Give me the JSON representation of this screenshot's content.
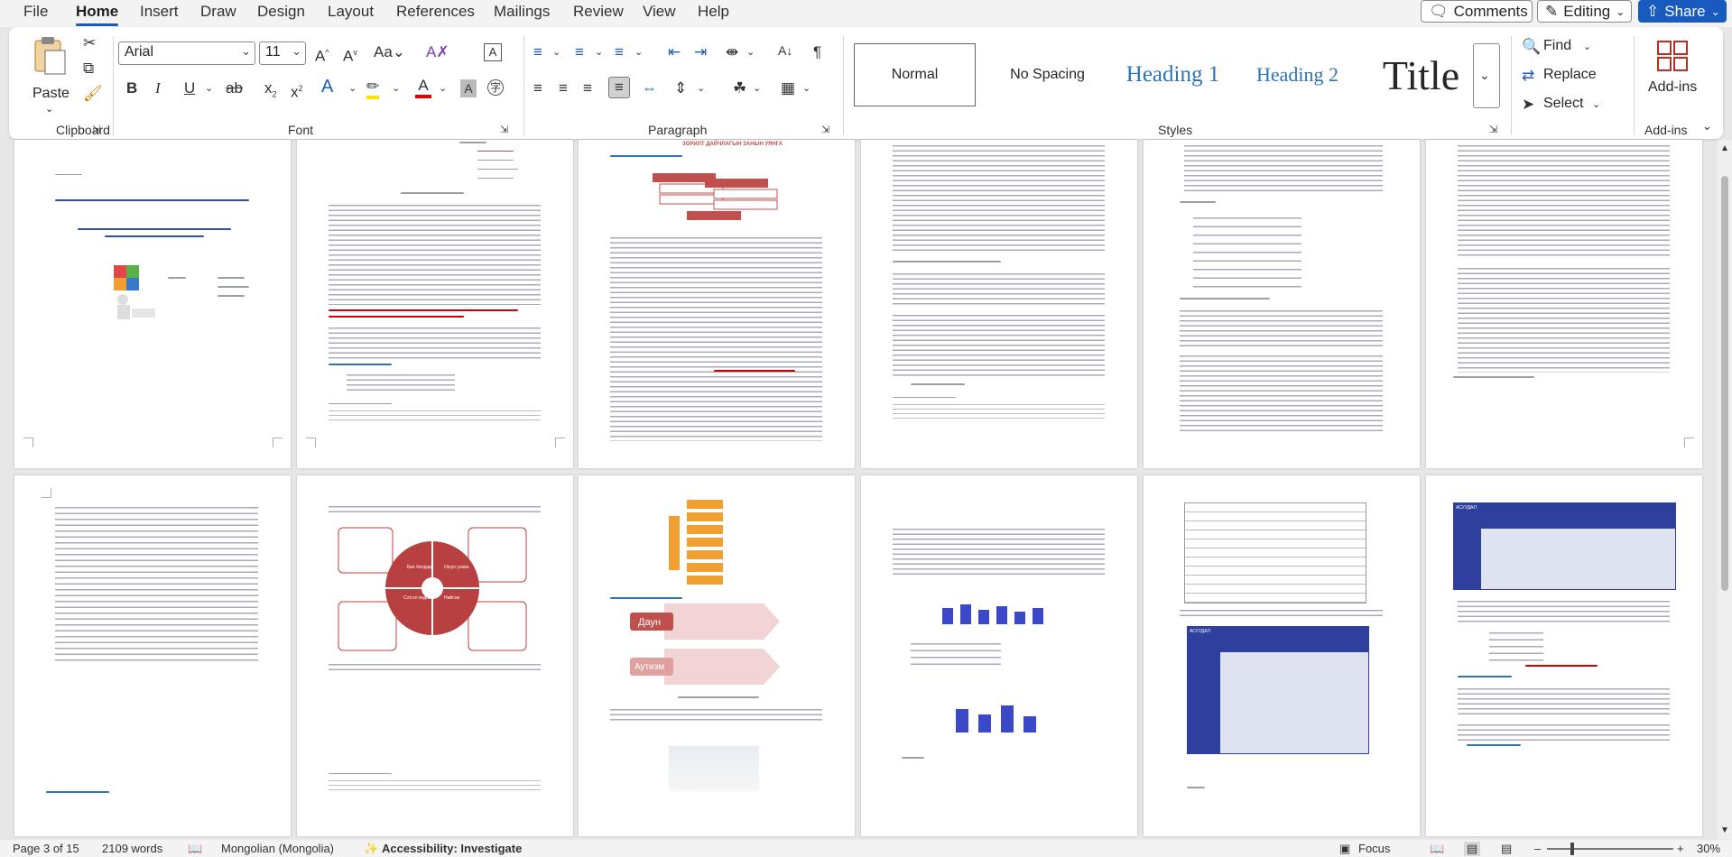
{
  "menu": {
    "tabs": [
      "File",
      "Home",
      "Insert",
      "Draw",
      "Design",
      "Layout",
      "References",
      "Mailings",
      "Review",
      "View",
      "Help"
    ],
    "active_tab": "Home",
    "comments_label": "Comments",
    "editing_label": "Editing",
    "share_label": "Share"
  },
  "ribbon": {
    "clipboard": {
      "label": "Clipboard",
      "paste_label": "Paste"
    },
    "font": {
      "label": "Font",
      "font_name": "Arial",
      "font_size": "11",
      "case_label": "Aa"
    },
    "paragraph": {
      "label": "Paragraph"
    },
    "styles": {
      "label": "Styles",
      "items": [
        "Normal",
        "No Spacing",
        "Heading 1",
        "Heading 2",
        "Title"
      ]
    },
    "editing": {
      "find_label": "Find",
      "replace_label": "Replace",
      "select_label": "Select"
    },
    "addins": {
      "label": "Add-ins",
      "button_label": "Add-ins"
    }
  },
  "document": {
    "page_text": {
      "title_red": "ЗОРИЛТ ДАЙЧЛАГЫН ЗАНЫН УЯНГА",
      "donut_labels": [
        "Бие бялдар",
        "Оюун ухаан",
        "Сэтгэл хөдлөл",
        "Нийгэм"
      ],
      "daun": "Даун",
      "autism": "Аутизм",
      "table_header": "АСУУДАЛ"
    }
  },
  "status": {
    "page": "Page 3 of 15",
    "words": "2109 words",
    "language": "Mongolian (Mongolia)",
    "accessibility": "Accessibility: Investigate",
    "focus": "Focus",
    "zoom": "30%"
  },
  "colors": {
    "accent": "#185abd",
    "heading_blue": "#2e74b5",
    "page_red": "#c0504d",
    "table_blue": "#2f3f9e",
    "donut_red": "#b84040"
  }
}
